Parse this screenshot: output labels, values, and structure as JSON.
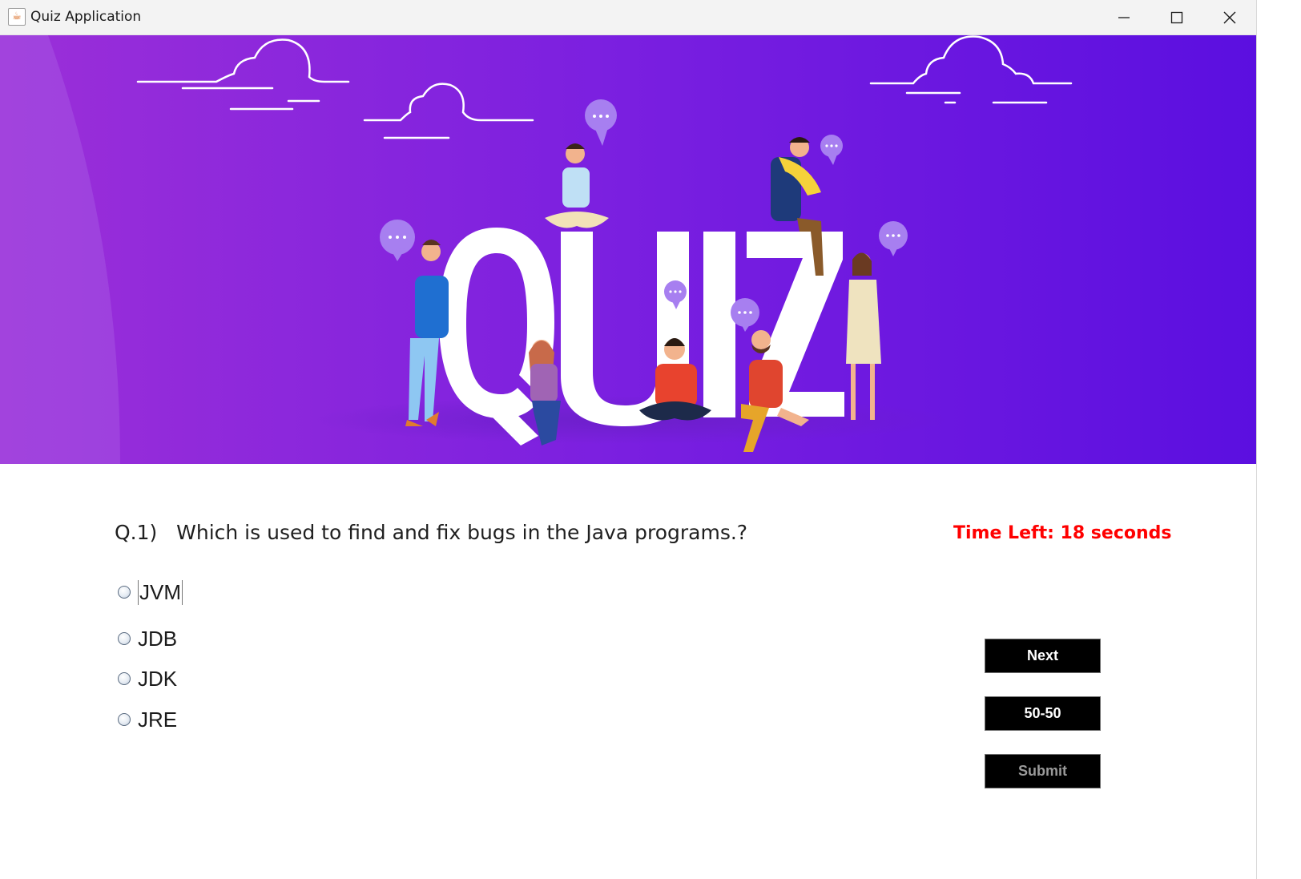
{
  "window": {
    "title": "Quiz Application",
    "icon": "java-cup-icon"
  },
  "banner": {
    "word": "QUIZ",
    "colors": {
      "left": "#9b2fd8",
      "right": "#5b0fe0",
      "glow": "#b37af0"
    }
  },
  "quiz": {
    "question_number": "Q.1)",
    "question_text": "Which is used to find and fix bugs in the Java programs.?",
    "timer_text": "Time Left: 18 seconds",
    "options": [
      {
        "label": "JVM",
        "selected": false
      },
      {
        "label": "JDB",
        "selected": false
      },
      {
        "label": "JDK",
        "selected": false
      },
      {
        "label": "JRE",
        "selected": false
      }
    ]
  },
  "actions": {
    "next_label": "Next",
    "fifty_label": "50-50",
    "submit_label": "Submit",
    "submit_enabled": false
  },
  "colors": {
    "timer": "#ff0000",
    "button_bg": "#000000",
    "button_text": "#ffffff"
  }
}
